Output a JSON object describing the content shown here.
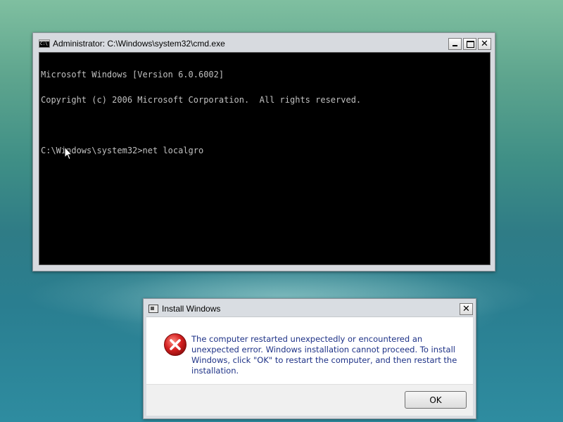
{
  "cmd_window": {
    "title": "Administrator: C:\\Windows\\system32\\cmd.exe",
    "buttons": {
      "minimize": "minimize-icon",
      "maximize": "maximize-icon",
      "close": "close-icon",
      "close_glyph": "✕"
    },
    "console_lines": [
      "Microsoft Windows [Version 6.0.6002]",
      "Copyright (c) 2006 Microsoft Corporation.  All rights reserved.",
      "",
      "C:\\Windows\\system32>net localgro"
    ]
  },
  "dialog": {
    "title": "Install Windows",
    "close_glyph": "✕",
    "icon": "error-icon",
    "message": "The computer restarted unexpectedly or encountered an unexpected error. Windows installation cannot proceed. To install Windows, click \"OK\" to restart the computer, and then restart the installation.",
    "ok_label": "OK"
  },
  "colors": {
    "console_bg": "#000000",
    "console_text": "#c0c0c0",
    "message_text": "#1e3287",
    "error_red": "#d42020"
  }
}
